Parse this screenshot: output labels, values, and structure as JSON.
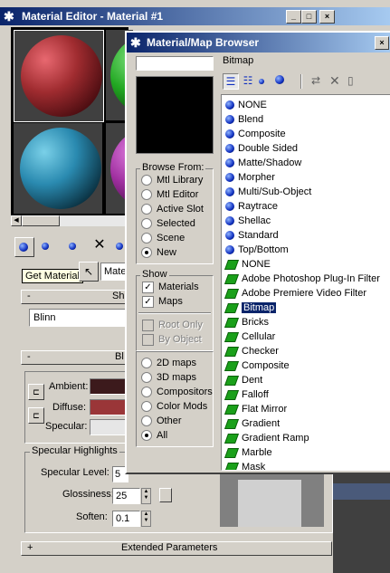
{
  "editor": {
    "title": "Material Editor - Material #1",
    "get_material_tooltip": "Get Material",
    "material_name": "Mate",
    "shader_rollout": "Sh",
    "shader_type": "Blinn",
    "basic_rollout": "Bl",
    "ambient_label": "Ambient:",
    "diffuse_label": "Diffuse:",
    "specular_label": "Specular:",
    "specular_highlights_label": "Specular Highlights",
    "specular_level_label": "Specular Level:",
    "specular_level_value": "5",
    "glossiness_label": "Glossiness:",
    "glossiness_value": "25",
    "soften_label": "Soften:",
    "soften_value": "0.1",
    "extended_params_label": "Extended Parameters",
    "minus_sign": "-",
    "plus_sign": "+",
    "colors": {
      "ambient": "#3c1a1c",
      "diffuse": "#9a3638",
      "specular": "#e6e6e6"
    }
  },
  "browser": {
    "title": "Material/Map Browser",
    "search_value": "",
    "current_name": "Bitmap",
    "browse_from_label": "Browse From:",
    "browse_from_options": [
      {
        "label": "Mtl Library",
        "selected": false
      },
      {
        "label": "Mtl Editor",
        "selected": false
      },
      {
        "label": "Active Slot",
        "selected": false
      },
      {
        "label": "Selected",
        "selected": false
      },
      {
        "label": "Scene",
        "selected": false
      },
      {
        "label": "New",
        "selected": true
      }
    ],
    "show_label": "Show",
    "show_materials": "Materials",
    "show_maps": "Maps",
    "root_only": "Root Only",
    "by_object": "By Object",
    "map_filter_options": [
      {
        "label": "2D maps",
        "selected": false
      },
      {
        "label": "3D maps",
        "selected": false
      },
      {
        "label": "Compositors",
        "selected": false
      },
      {
        "label": "Color Mods",
        "selected": false
      },
      {
        "label": "Other",
        "selected": false
      },
      {
        "label": "All",
        "selected": true
      }
    ],
    "check_mark": "✓",
    "list_items": [
      {
        "label": "NONE",
        "kind": "material"
      },
      {
        "label": "Blend",
        "kind": "material"
      },
      {
        "label": "Composite",
        "kind": "material"
      },
      {
        "label": "Double Sided",
        "kind": "material"
      },
      {
        "label": "Matte/Shadow",
        "kind": "material"
      },
      {
        "label": "Morpher",
        "kind": "material"
      },
      {
        "label": "Multi/Sub-Object",
        "kind": "material"
      },
      {
        "label": "Raytrace",
        "kind": "material"
      },
      {
        "label": "Shellac",
        "kind": "material"
      },
      {
        "label": "Standard",
        "kind": "material"
      },
      {
        "label": "Top/Bottom",
        "kind": "material"
      },
      {
        "label": "NONE",
        "kind": "map"
      },
      {
        "label": "Adobe Photoshop Plug-In Filter",
        "kind": "map"
      },
      {
        "label": "Adobe Premiere Video Filter",
        "kind": "map"
      },
      {
        "label": "Bitmap",
        "kind": "map",
        "selected": true
      },
      {
        "label": "Bricks",
        "kind": "map"
      },
      {
        "label": "Cellular",
        "kind": "map"
      },
      {
        "label": "Checker",
        "kind": "map"
      },
      {
        "label": "Composite",
        "kind": "map"
      },
      {
        "label": "Dent",
        "kind": "map"
      },
      {
        "label": "Falloff",
        "kind": "map"
      },
      {
        "label": "Flat Mirror",
        "kind": "map"
      },
      {
        "label": "Gradient",
        "kind": "map"
      },
      {
        "label": "Gradient Ramp",
        "kind": "map"
      },
      {
        "label": "Marble",
        "kind": "map"
      },
      {
        "label": "Mask",
        "kind": "map"
      }
    ]
  }
}
